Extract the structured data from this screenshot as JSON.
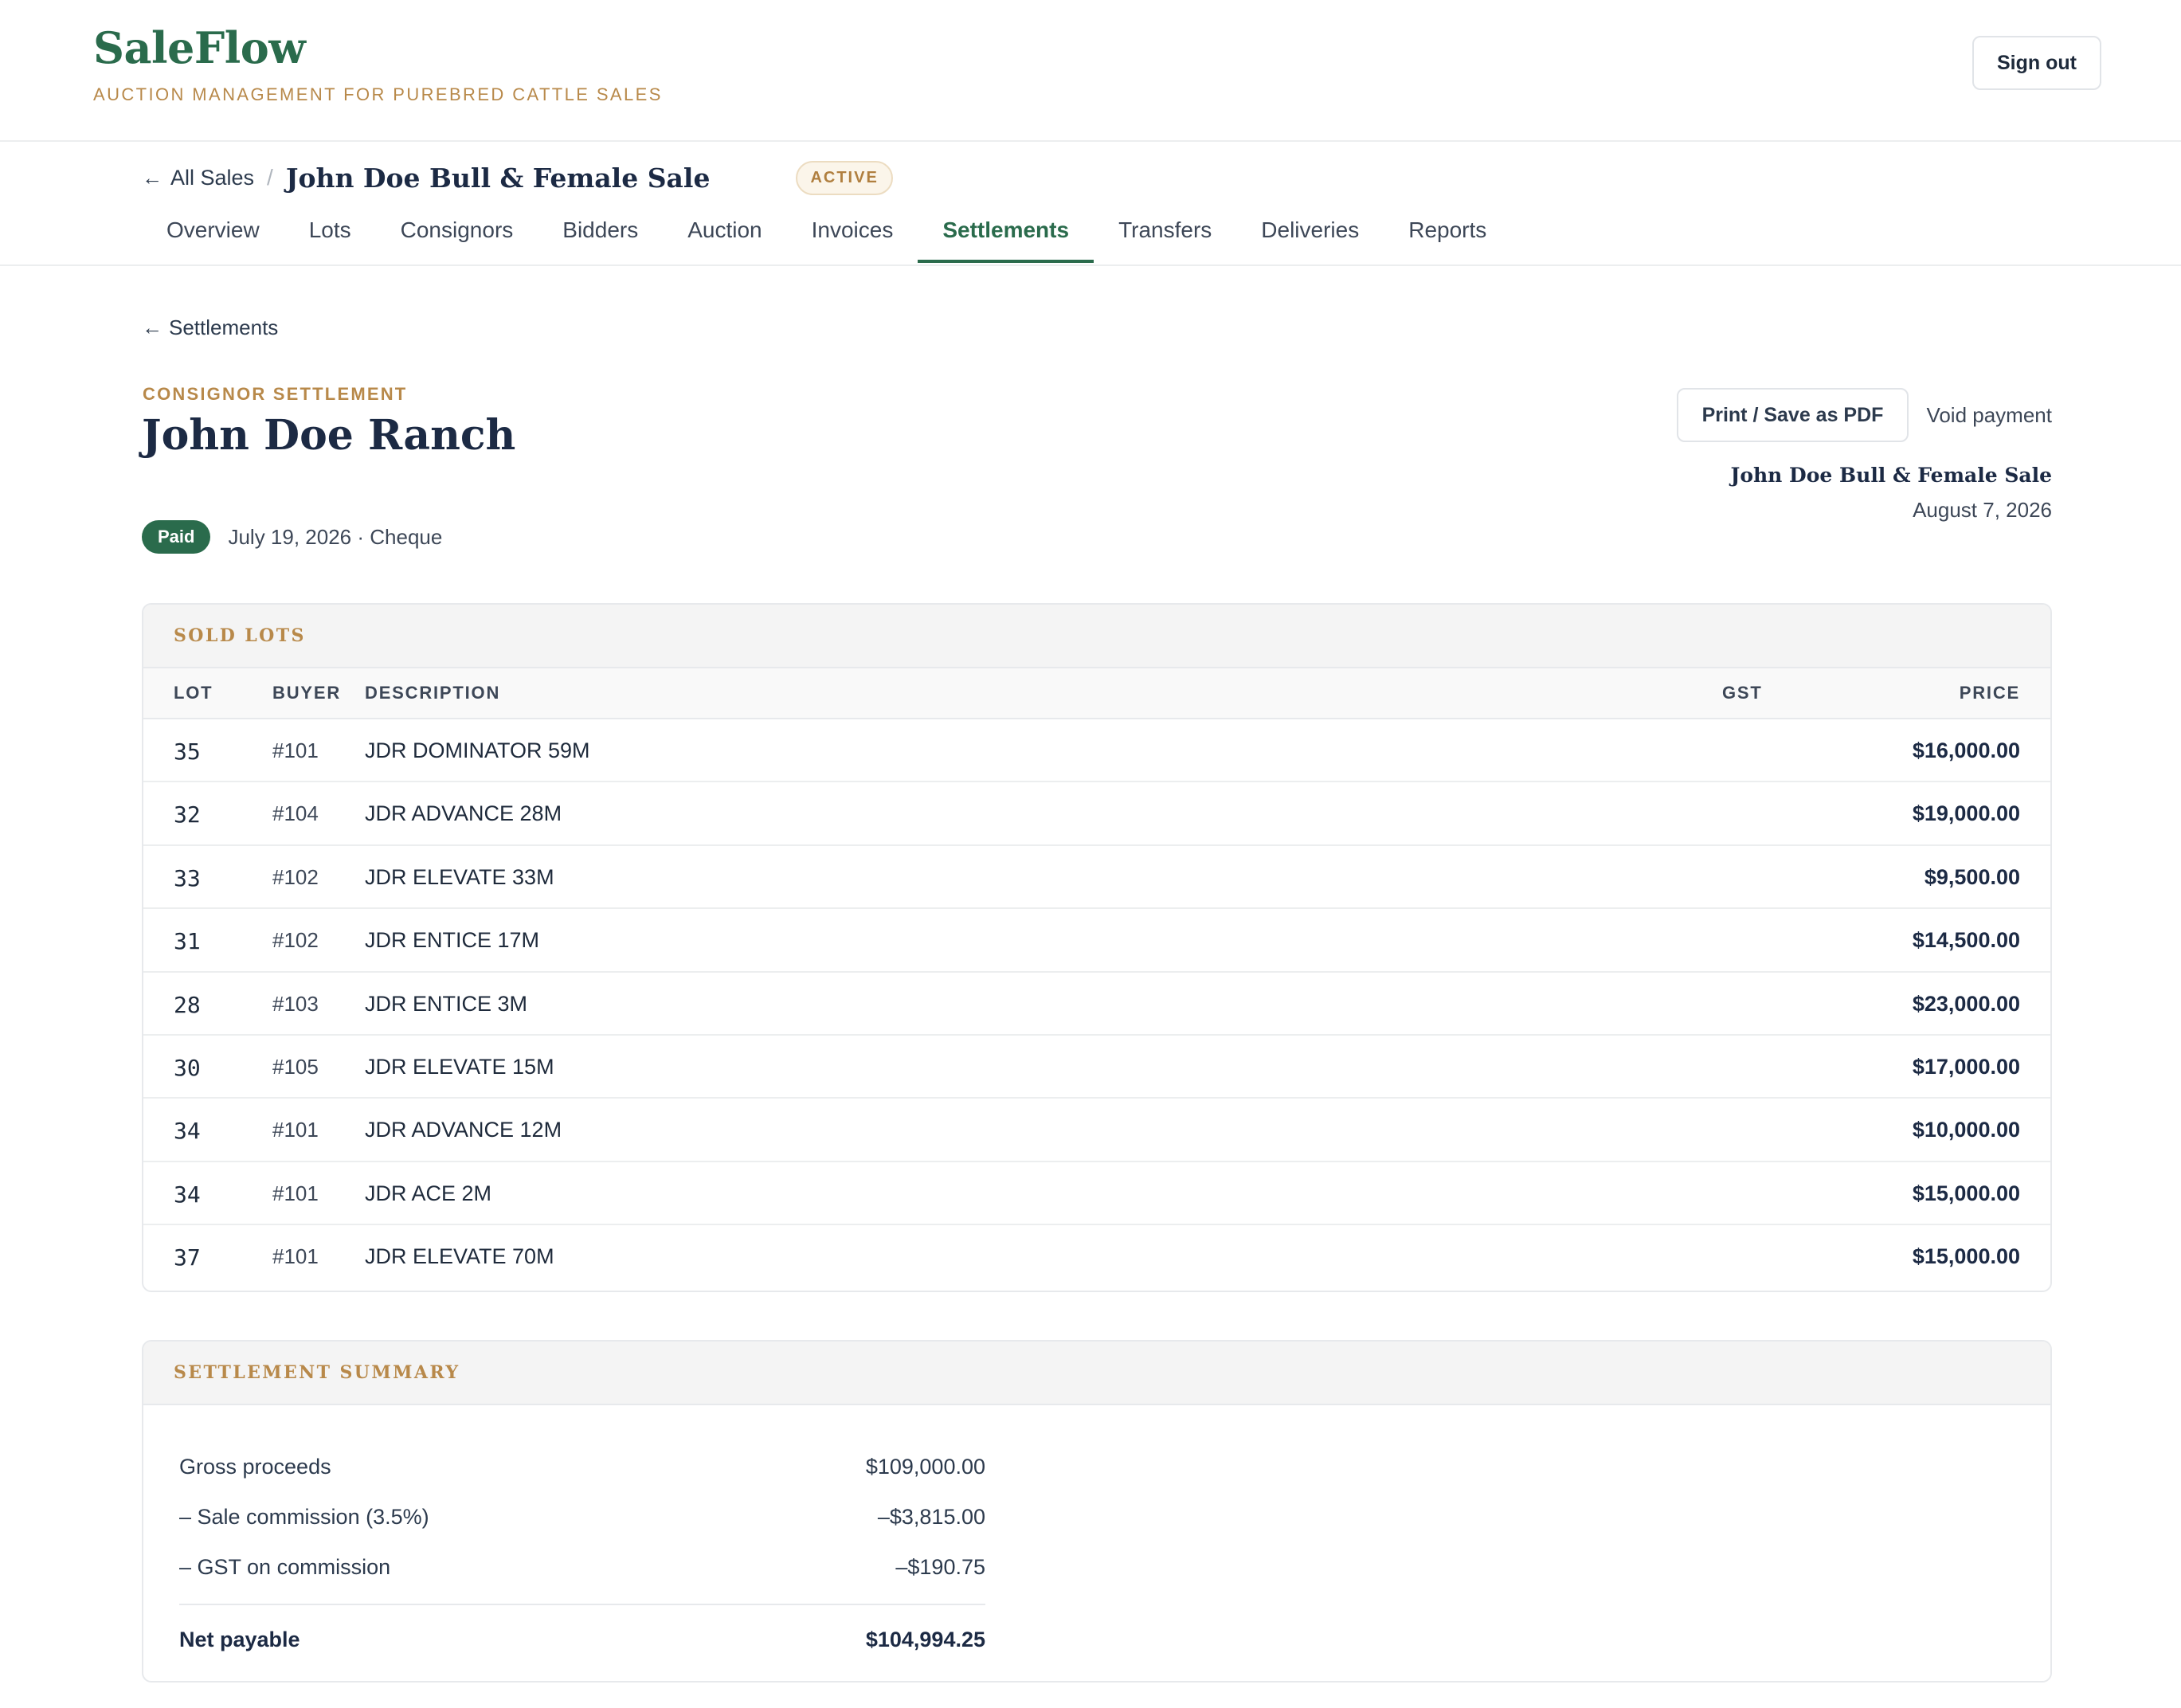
{
  "app": {
    "name": "SaleFlow",
    "tagline": "AUCTION MANAGEMENT FOR PUREBRED CATTLE SALES",
    "sign_out": "Sign out"
  },
  "sale": {
    "back_label": "All Sales",
    "separator": "/",
    "title": "John Doe Bull & Female Sale",
    "status": "ACTIVE",
    "tabs": [
      {
        "label": "Overview"
      },
      {
        "label": "Lots"
      },
      {
        "label": "Consignors"
      },
      {
        "label": "Bidders"
      },
      {
        "label": "Auction"
      },
      {
        "label": "Invoices"
      },
      {
        "label": "Settlements",
        "active": true
      },
      {
        "label": "Transfers"
      },
      {
        "label": "Deliveries"
      },
      {
        "label": "Reports"
      }
    ]
  },
  "page": {
    "back_label": "Settlements",
    "eyebrow": "CONSIGNOR SETTLEMENT",
    "title": "John Doe Ranch",
    "paid_badge": "Paid",
    "paid_meta": "July 19, 2026 · Cheque",
    "print_button": "Print / Save as PDF",
    "void_button": "Void payment",
    "sale_name": "John Doe Bull & Female Sale",
    "sale_date": "August 7, 2026"
  },
  "sold_lots": {
    "heading": "SOLD LOTS",
    "columns": {
      "lot": "LOT",
      "buyer": "BUYER",
      "description": "DESCRIPTION",
      "gst": "GST",
      "price": "PRICE"
    },
    "rows": [
      {
        "lot": "35",
        "buyer": "#101",
        "description": "JDR DOMINATOR 59M",
        "gst": "",
        "price": "$16,000.00"
      },
      {
        "lot": "32",
        "buyer": "#104",
        "description": "JDR ADVANCE 28M",
        "gst": "",
        "price": "$19,000.00"
      },
      {
        "lot": "33",
        "buyer": "#102",
        "description": "JDR ELEVATE 33M",
        "gst": "",
        "price": "$9,500.00"
      },
      {
        "lot": "31",
        "buyer": "#102",
        "description": "JDR ENTICE 17M",
        "gst": "",
        "price": "$14,500.00"
      },
      {
        "lot": "28",
        "buyer": "#103",
        "description": "JDR ENTICE 3M",
        "gst": "",
        "price": "$23,000.00"
      },
      {
        "lot": "30",
        "buyer": "#105",
        "description": "JDR ELEVATE 15M",
        "gst": "",
        "price": "$17,000.00"
      },
      {
        "lot": "34",
        "buyer": "#101",
        "description": "JDR ADVANCE 12M",
        "gst": "",
        "price": "$10,000.00"
      },
      {
        "lot": "34",
        "buyer": "#101",
        "description": "JDR ACE 2M",
        "gst": "",
        "price": "$15,000.00"
      },
      {
        "lot": "37",
        "buyer": "#101",
        "description": "JDR ELEVATE 70M",
        "gst": "",
        "price": "$15,000.00"
      }
    ]
  },
  "summary": {
    "heading": "SETTLEMENT SUMMARY",
    "lines": [
      {
        "label": "Gross proceeds",
        "value": "$109,000.00"
      },
      {
        "label": "– Sale commission (3.5%)",
        "value": "–$3,815.00"
      },
      {
        "label": "– GST on commission",
        "value": "–$190.75"
      }
    ],
    "total": {
      "label": "Net payable",
      "value": "$104,994.25"
    }
  },
  "colors": {
    "brand_green": "#2a6b4c",
    "accent_gold": "#b8894a",
    "text_navy": "#1c2a44"
  }
}
